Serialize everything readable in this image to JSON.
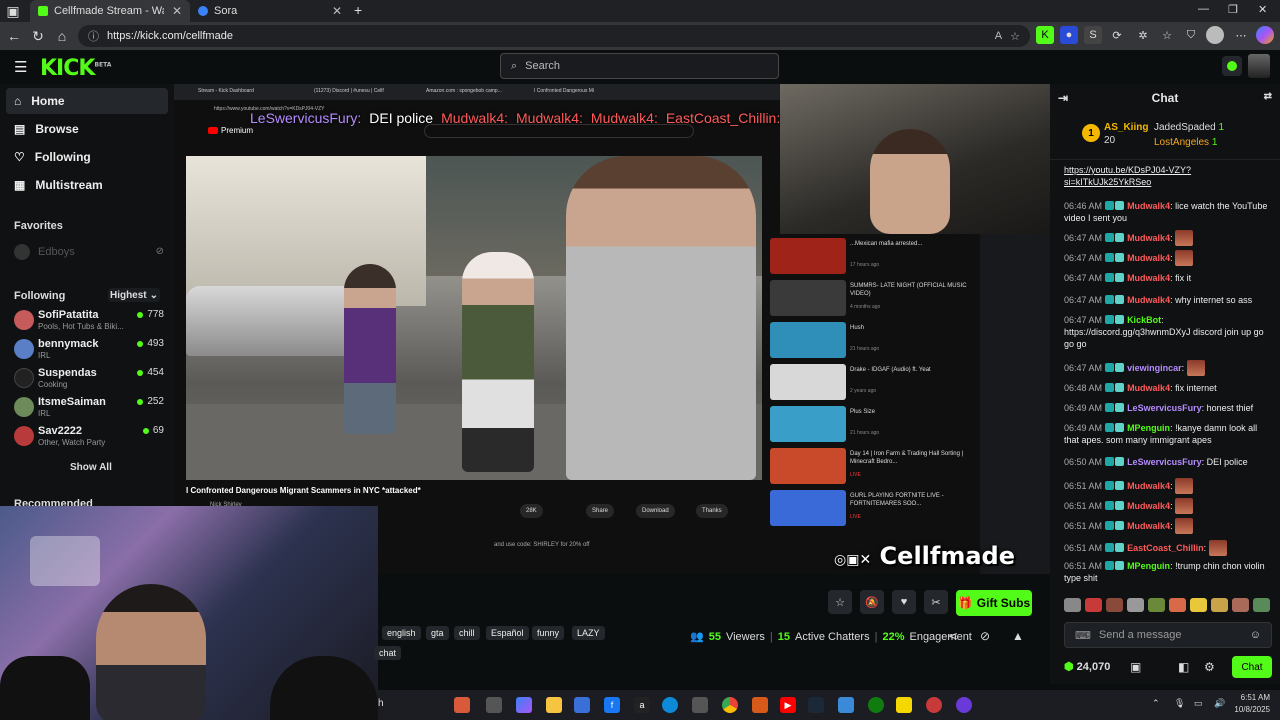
{
  "browser": {
    "tabs": [
      {
        "title": "Cellfmade Stream - Watch Li",
        "active": true
      },
      {
        "title": "Sora",
        "active": false
      }
    ],
    "url": "https://kick.com/cellfmade"
  },
  "header": {
    "logo": "KICK",
    "logo_sup": "BETA",
    "search_placeholder": "Search"
  },
  "sidebar": {
    "nav": [
      {
        "label": "Home",
        "icon": "home-icon",
        "active": true
      },
      {
        "label": "Browse",
        "icon": "browse-icon"
      },
      {
        "label": "Following",
        "icon": "heart-icon"
      },
      {
        "label": "Multistream",
        "icon": "grid-icon"
      }
    ],
    "favorites_title": "Favorites",
    "favorites": [
      {
        "name": "Edboys"
      }
    ],
    "following_title": "Following",
    "sort_label": "Highest",
    "following": [
      {
        "name": "SofiPatatita",
        "category": "Pools, Hot Tubs & Biki...",
        "viewers": "778",
        "color": "#c75a5a"
      },
      {
        "name": "bennymack",
        "category": "IRL",
        "viewers": "493",
        "color": "#5a7fc7"
      },
      {
        "name": "Suspendas",
        "category": "Cooking",
        "viewers": "454",
        "color": "#222222"
      },
      {
        "name": "ItsmeSaiman",
        "category": "IRL",
        "viewers": "252",
        "color": "#6d8a5a"
      },
      {
        "name": "Sav2222",
        "category": "Other, Watch Party",
        "viewers": "69",
        "color": "#b83a3a"
      }
    ],
    "show_all": "Show All",
    "recommended_title": "Recommended"
  },
  "stream": {
    "inner_tabs": [
      "Stream - Kick Dashboard",
      "(11273) Discord | #unesu | Cellf",
      "Amazon.com : spongebob camp...",
      "I Confronted Dangerous Mi"
    ],
    "inner_url": "https://www.youtube.com/watch?v=KDsPJ04-VZY",
    "youtube_label": "Premium",
    "overlay_messages": [
      {
        "user": "LeSwervicusFury:",
        "text": "DEI police",
        "color": "#b58cff"
      },
      {
        "user": "Mudwalk4:",
        "text": "",
        "color": "#ff5a5a"
      },
      {
        "user": "Mudwalk4:",
        "text": "",
        "color": "#ff5a5a"
      },
      {
        "user": "Mudwalk4:",
        "text": "",
        "color": "#ff5a5a"
      },
      {
        "user": "EastCoast_Chillin:",
        "text": "",
        "color": "#ff5a5a"
      }
    ],
    "video_title": "I Confronted Dangerous Migrant Scammers in NYC *attacked*",
    "channel": "Nick Shirley",
    "yt_actions": [
      "28K",
      "Share",
      "Download",
      "Thanks"
    ],
    "promo": "and use code: SHIRLEY for 20% off",
    "side_videos": [
      {
        "title": "...Mexican mafia arrested...",
        "meta": "17 hours ago",
        "duration": "2:23",
        "color": "#a0231a"
      },
      {
        "title": "SUMMRS- LATE NIGHT (OFFICIAL MUSIC VIDEO)",
        "meta": "4 months ago",
        "duration": "2:52",
        "color": "#3a3a3a"
      },
      {
        "title": "Hush",
        "meta": "21 hours ago",
        "duration": "2:42",
        "color": "#2f8fb8"
      },
      {
        "title": "Drake - IDGAF (Audio) ft. Yeat",
        "meta": "2 years ago",
        "duration": "4:21",
        "color": "#d8d8d8"
      },
      {
        "title": "Plus Size",
        "meta": "21 hours ago",
        "duration": "2:42",
        "color": "#3a9fc8"
      },
      {
        "title": "Day 14 | Iron Farm & Trading Hall Sorting | Minecraft Bedro...",
        "meta": "LIVE",
        "duration": "LIVE",
        "color": "#c84a2a"
      },
      {
        "title": "GURL PLAYING FORTNITE LIVE - FORTNITEMARES SOO...",
        "meta": "LIVE",
        "duration": "LIVE",
        "color": "#3a6ad8"
      }
    ],
    "watermark": "Cellfmade"
  },
  "below_stream": {
    "gift_label": "Gift Subs",
    "tags": [
      "english",
      "gta",
      "chill",
      "Español",
      "funny",
      "LAZY"
    ],
    "extra_tag": "chat",
    "viewers": "55",
    "viewers_label": "Viewers",
    "chatters": "15",
    "chatters_label": "Active Chatters",
    "engagement": "22%",
    "engagement_label": "Engagement"
  },
  "chat": {
    "title": "Chat",
    "top_gifter": {
      "rank": "1",
      "name": "AS_Kiing",
      "count": "20"
    },
    "pinned_users": [
      {
        "name": "JadedSpaded",
        "count": "1"
      },
      {
        "name": "LostAngeles",
        "count": "1"
      }
    ],
    "messages": [
      {
        "time": "",
        "user": "",
        "color": "#eee",
        "text": "https://youtu.be/KDsPJ04-VZY?si=kITkUJk25YkRSeo",
        "link": true
      },
      {
        "time": "06:46 AM",
        "user": "Mudwalk4",
        "color": "#ff5a5a",
        "text": "lice watch the YouTube video I sent you"
      },
      {
        "time": "06:47 AM",
        "user": "Mudwalk4",
        "color": "#ff5a5a",
        "text": "",
        "emote": true
      },
      {
        "time": "06:47 AM",
        "user": "Mudwalk4",
        "color": "#ff5a5a",
        "text": "",
        "emote": true
      },
      {
        "time": "06:47 AM",
        "user": "Mudwalk4",
        "color": "#ff5a5a",
        "text": "fix it"
      },
      {
        "time": "06:47 AM",
        "user": "Mudwalk4",
        "color": "#ff5a5a",
        "text": "why internet so ass"
      },
      {
        "time": "06:47 AM",
        "user": "KickBot",
        "color": "#53fc18",
        "text": "https://discord.gg/q3hwnmDXyJ discord join up go go go"
      },
      {
        "time": "06:47 AM",
        "user": "viewingincar",
        "color": "#b58cff",
        "text": "",
        "emote": true
      },
      {
        "time": "06:48 AM",
        "user": "Mudwalk4",
        "color": "#ff5a5a",
        "text": "fix internet"
      },
      {
        "time": "06:49 AM",
        "user": "LeSwervicusFury",
        "color": "#b58cff",
        "text": "honest thief"
      },
      {
        "time": "06:49 AM",
        "user": "MPenguin",
        "color": "#53fc18",
        "text": "!kanye damn look all that apes. som many immigrant apes"
      },
      {
        "time": "06:50 AM",
        "user": "LeSwervicusFury",
        "color": "#b58cff",
        "text": "DEI police"
      },
      {
        "time": "06:51 AM",
        "user": "Mudwalk4",
        "color": "#ff5a5a",
        "text": "",
        "emote": true
      },
      {
        "time": "06:51 AM",
        "user": "Mudwalk4",
        "color": "#ff5a5a",
        "text": "",
        "emote": true
      },
      {
        "time": "06:51 AM",
        "user": "Mudwalk4",
        "color": "#ff5a5a",
        "text": "",
        "emote": true
      },
      {
        "time": "06:51 AM",
        "user": "EastCoast_Chillin",
        "color": "#ff5a5a",
        "text": "",
        "emote": true
      },
      {
        "time": "06:51 AM",
        "user": "MPenguin",
        "color": "#53fc18",
        "text": "!trump chin chon violin type shit"
      }
    ],
    "input_placeholder": "Send a message",
    "points": "24,070",
    "send_label": "Chat"
  },
  "taskbar": {
    "search_label": "h",
    "time": "6:51 AM",
    "date": "10/8/2025"
  },
  "colors": {
    "accent": "#53fc18",
    "background": "#0b0e0f"
  }
}
